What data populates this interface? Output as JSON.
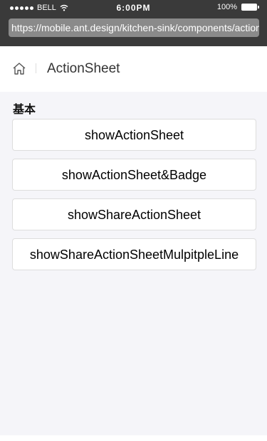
{
  "status_bar": {
    "carrier": "BELL",
    "time": "6:00PM",
    "battery": "100%"
  },
  "browser": {
    "url": "https://mobile.ant.design/kitchen-sink/components/action-sheet"
  },
  "navbar": {
    "title": "ActionSheet"
  },
  "section": {
    "title": "基本"
  },
  "buttons": [
    {
      "label": "showActionSheet"
    },
    {
      "label": "showActionSheet&Badge"
    },
    {
      "label": "showShareActionSheet"
    },
    {
      "label": "showShareActionSheetMulpitpleLine"
    }
  ]
}
